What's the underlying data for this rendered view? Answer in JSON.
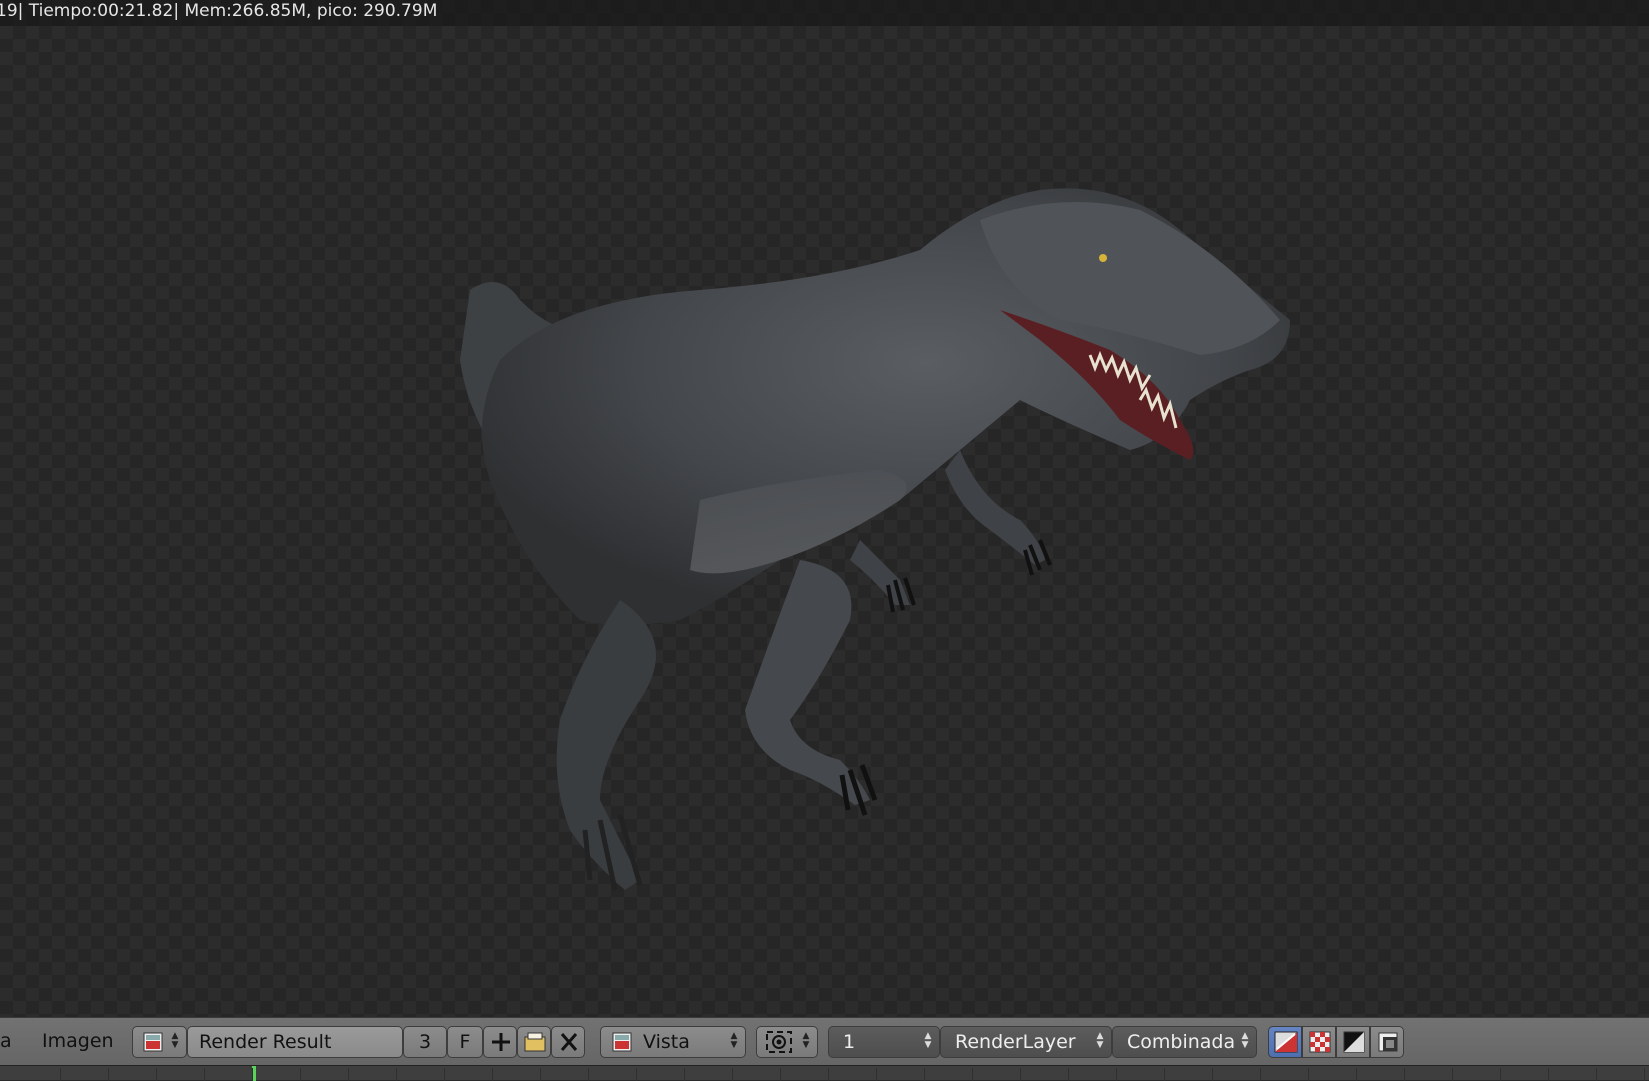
{
  "render_info": {
    "text": "19| Tiempo:00:21.82| Mem:266.85M, pico: 290.79M"
  },
  "viewport": {
    "subject": "dinosaur render"
  },
  "header": {
    "menu_partial": "a",
    "menu_image": "Imagen",
    "image_name": "Render Result",
    "user_count": "3",
    "fake_user": "F",
    "view_select": "Vista",
    "slot": "1",
    "layer": "RenderLayer",
    "pass": "Combinada"
  },
  "icons": {
    "image_browse": "image-icon",
    "new_image": "plus-icon",
    "open_image": "folder-icon",
    "unlink_image": "x-icon",
    "view_icon": "image-icon",
    "camera_icon": "camera-icon",
    "draw_rgb": "color-alpha-icon",
    "draw_alpha": "checker-icon",
    "draw_z": "z-buffer-icon",
    "draw_other": "channel-icon"
  },
  "colors": {
    "active_button": "#5676b8",
    "frame_marker": "#5ad35a"
  }
}
